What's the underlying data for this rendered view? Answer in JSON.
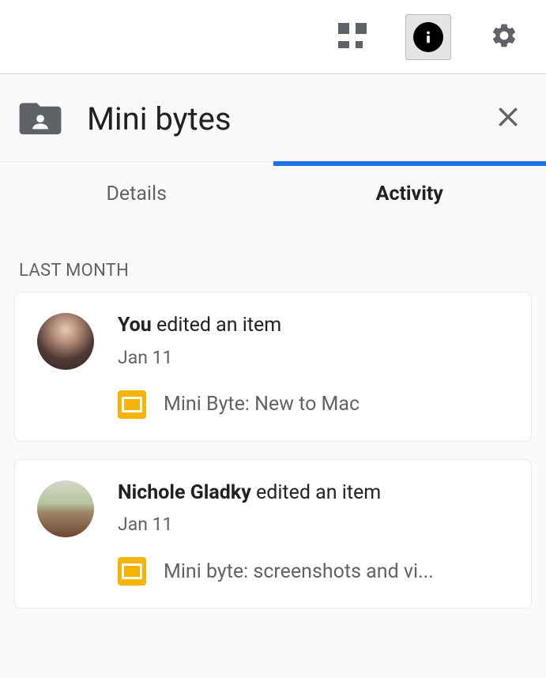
{
  "header": {
    "title": "Mini bytes"
  },
  "tabs": {
    "details": "Details",
    "activity": "Activity"
  },
  "section": {
    "last_month": "LAST MONTH"
  },
  "activities": [
    {
      "actor": "You",
      "action": " edited an item",
      "date": "Jan 11",
      "file_icon": "slides-icon",
      "file_name": "Mini Byte: New to Mac"
    },
    {
      "actor": "Nichole Gladky",
      "action": " edited an item",
      "date": "Jan 11",
      "file_icon": "slides-icon",
      "file_name": "Mini byte: screenshots and vi..."
    }
  ]
}
